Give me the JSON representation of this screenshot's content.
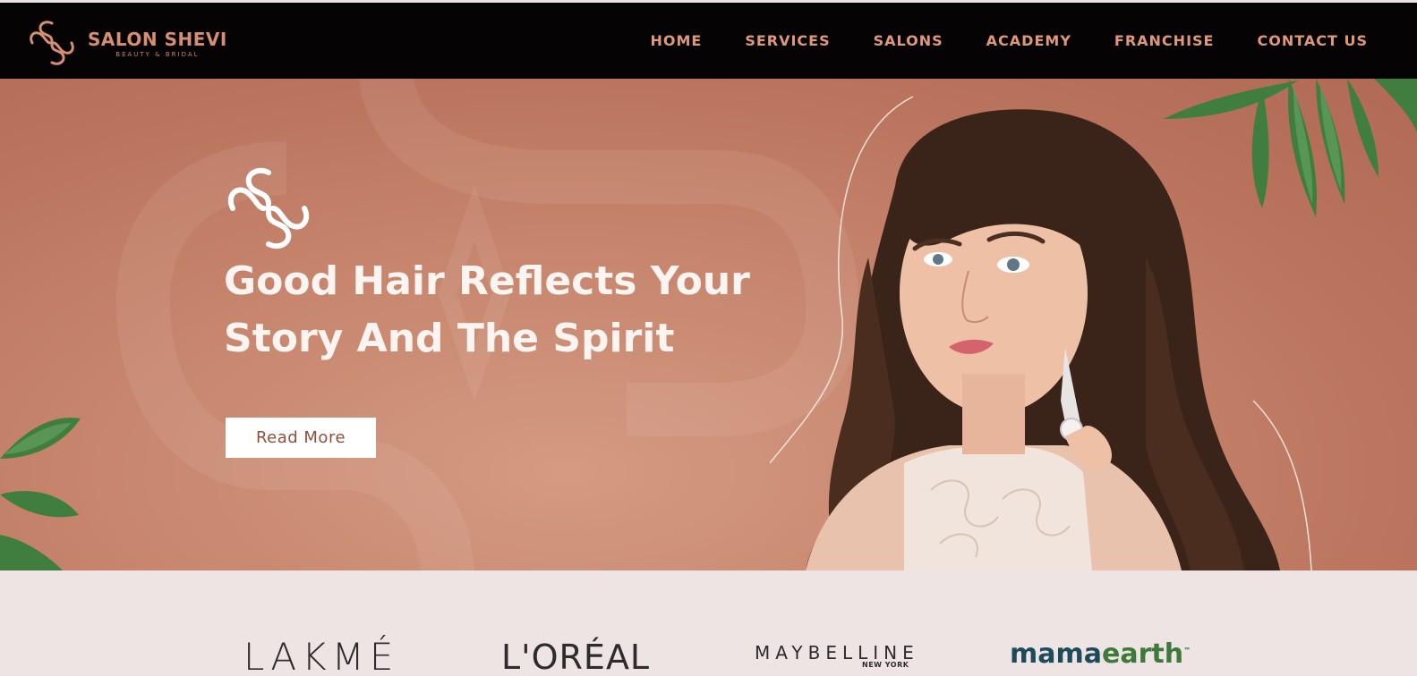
{
  "header": {
    "brand_name": "SALON SHEVI",
    "brand_tagline": "BEAUTY & BRIDAL",
    "logo_icon": "salon-shevi-swirl-logo",
    "nav": [
      {
        "label": "HOME"
      },
      {
        "label": "SERVICES"
      },
      {
        "label": "SALONS"
      },
      {
        "label": "ACADEMY"
      },
      {
        "label": "FRANCHISE"
      },
      {
        "label": "CONTACT US"
      }
    ]
  },
  "hero": {
    "title_line1": "Good Hair Reflects Your",
    "title_line2": "Story And The Spirit",
    "cta_label": "Read More",
    "image": "woman-with-curly-hair-portrait"
  },
  "partners": {
    "lakme": "LAKMÉ",
    "loreal": "L'ORÉAL",
    "maybelline": "MAYBELLINE",
    "maybelline_sub": "NEW YORK",
    "mamaearth_a": "mama",
    "mamaearth_b": "earth",
    "mamaearth_tm": "™"
  },
  "colors": {
    "nav_bg": "#050303",
    "nav_text": "#e0987a",
    "hero_bg": "#c7856d",
    "hero_text": "#fbf4f1",
    "cta_text": "#8e4f3c",
    "strip_bg": "#efe4e4"
  }
}
